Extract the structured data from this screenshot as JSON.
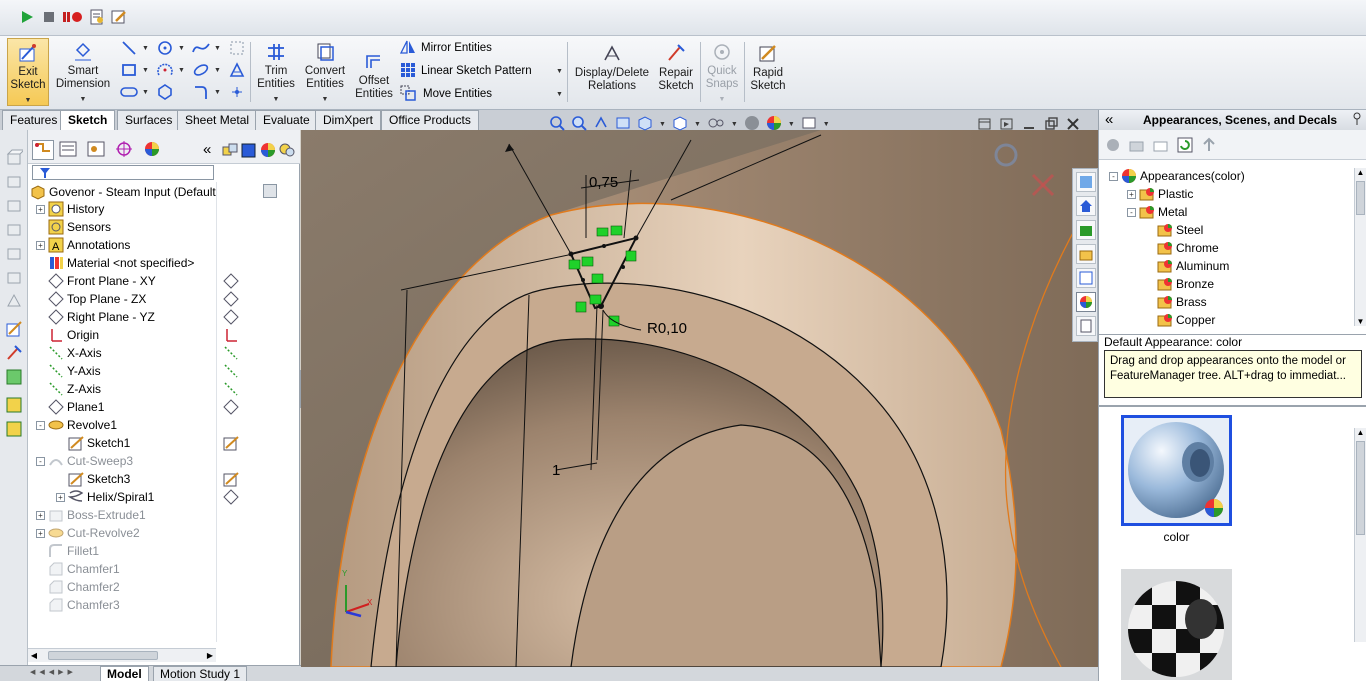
{
  "ribbon": {
    "exit_sketch": "Exit\nSketch",
    "smart_dimension": "Smart\nDimension",
    "trim_entities": "Trim\nEntities",
    "convert_entities": "Convert\nEntities",
    "offset_entities": "Offset\nEntities",
    "mirror_entities": "Mirror Entities",
    "linear_sketch_pattern": "Linear Sketch Pattern",
    "move_entities": "Move Entities",
    "display_delete_relations": "Display/Delete\nRelations",
    "repair_sketch": "Repair\nSketch",
    "quick_snaps": "Quick\nSnaps",
    "rapid_sketch": "Rapid\nSketch"
  },
  "tabs": [
    "Features",
    "Sketch",
    "Surfaces",
    "Sheet Metal",
    "Evaluate",
    "DimXpert",
    "Office Products"
  ],
  "active_tab": "Sketch",
  "feature_tree": {
    "root": "Govenor - Steam Input  (Default",
    "items": [
      {
        "label": "History",
        "icon": "history-icon",
        "expand": "+"
      },
      {
        "label": "Sensors",
        "icon": "sensors-icon",
        "expand": ""
      },
      {
        "label": "Annotations",
        "icon": "annotations-icon",
        "expand": "+"
      },
      {
        "label": "Material <not specified>",
        "icon": "material-icon",
        "expand": ""
      },
      {
        "label": "Front Plane - XY",
        "icon": "plane-icon",
        "expand": ""
      },
      {
        "label": "Top Plane - ZX",
        "icon": "plane-icon",
        "expand": ""
      },
      {
        "label": "Right Plane - YZ",
        "icon": "plane-icon",
        "expand": ""
      },
      {
        "label": "Origin",
        "icon": "origin-icon",
        "expand": ""
      },
      {
        "label": "X-Axis",
        "icon": "axis-icon",
        "expand": ""
      },
      {
        "label": "Y-Axis",
        "icon": "axis-icon",
        "expand": ""
      },
      {
        "label": "Z-Axis",
        "icon": "axis-icon",
        "expand": ""
      },
      {
        "label": "Plane1",
        "icon": "plane-icon",
        "expand": ""
      },
      {
        "label": "Revolve1",
        "icon": "revolve-icon",
        "expand": "-"
      },
      {
        "label": "Sketch1",
        "icon": "sketch-icon",
        "expand": "",
        "indent": 1
      },
      {
        "label": "Cut-Sweep3",
        "icon": "sweep-icon",
        "expand": "-",
        "grey": true
      },
      {
        "label": "Sketch3",
        "icon": "sketch-icon",
        "expand": "",
        "indent": 1
      },
      {
        "label": "Helix/Spiral1",
        "icon": "helix-icon",
        "expand": "+",
        "indent": 1
      },
      {
        "label": "Boss-Extrude1",
        "icon": "extrude-icon",
        "expand": "+",
        "grey": true
      },
      {
        "label": "Cut-Revolve2",
        "icon": "revolve-icon",
        "expand": "+",
        "grey": true
      },
      {
        "label": "Fillet1",
        "icon": "fillet-icon",
        "expand": "",
        "grey": true
      },
      {
        "label": "Chamfer1",
        "icon": "chamfer-icon",
        "expand": "",
        "grey": true
      },
      {
        "label": "Chamfer2",
        "icon": "chamfer-icon",
        "expand": "",
        "grey": true
      },
      {
        "label": "Chamfer3",
        "icon": "chamfer-icon",
        "expand": "",
        "grey": true
      }
    ]
  },
  "bottom_tabs": [
    "Model",
    "Motion Study 1"
  ],
  "viewport": {
    "dim_top": "0,75",
    "dim_radius": "R0,10",
    "dim_one": "1",
    "triad": {
      "y": "Y",
      "x": "X"
    }
  },
  "task_panel": {
    "title": "Appearances, Scenes, and Decals",
    "tree": [
      {
        "label": "Appearances(color)",
        "level": 0,
        "expand": "-"
      },
      {
        "label": "Plastic",
        "level": 1,
        "expand": "+"
      },
      {
        "label": "Metal",
        "level": 1,
        "expand": "-"
      },
      {
        "label": "Steel",
        "level": 2,
        "expand": ""
      },
      {
        "label": "Chrome",
        "level": 2,
        "expand": ""
      },
      {
        "label": "Aluminum",
        "level": 2,
        "expand": ""
      },
      {
        "label": "Bronze",
        "level": 2,
        "expand": ""
      },
      {
        "label": "Brass",
        "level": 2,
        "expand": ""
      },
      {
        "label": "Copper",
        "level": 2,
        "expand": ""
      }
    ],
    "default_appearance": "Default Appearance: color",
    "tip": "Drag and drop appearances onto the model or FeatureManager tree.  ALT+drag to immediat...",
    "thumb1_label": "color"
  },
  "colors": {
    "accent_blue": "#1f4fe0",
    "sketch_green": "#1fd12a",
    "model_edge": "#e07a1c",
    "model_face": "#c4a88f"
  }
}
